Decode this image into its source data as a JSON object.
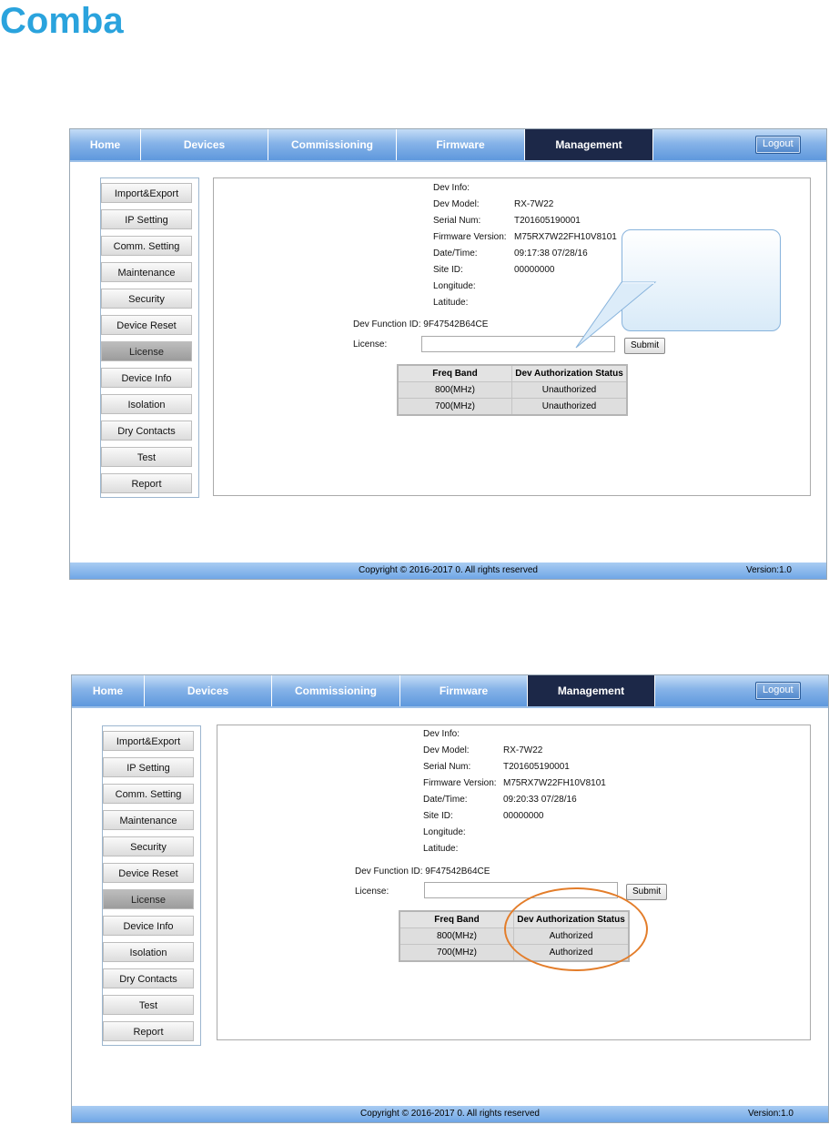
{
  "brand": {
    "logo_text": "Comba"
  },
  "screens": [
    {
      "nav": {
        "tabs": [
          "Home",
          "Devices",
          "Commissioning",
          "Firmware",
          "Management"
        ],
        "active": "Management",
        "logout": "Logout"
      },
      "menu": [
        "Import&Export",
        "IP Setting",
        "Comm. Setting",
        "Maintenance",
        "Security",
        "Device Reset",
        "License",
        "Device Info",
        "Isolation",
        "Dry Contacts",
        "Test",
        "Report"
      ],
      "active_menu": "License",
      "dev_info": {
        "title": "Dev Info:",
        "rows": [
          {
            "label": "Dev Model:",
            "value": "RX-7W22"
          },
          {
            "label": "Serial Num:",
            "value": "T201605190001"
          },
          {
            "label": "Firmware Version:",
            "value": "M75RX7W22FH10V8101"
          },
          {
            "label": "Date/Time:",
            "value": "09:17:38 07/28/16"
          },
          {
            "label": "Site ID:",
            "value": "00000000"
          },
          {
            "label": "Longitude:",
            "value": ""
          },
          {
            "label": "Latitude:",
            "value": ""
          }
        ]
      },
      "function_id": "Dev Function ID: 9F47542B64CE",
      "license": {
        "label": "License:",
        "value": "",
        "submit": "Submit"
      },
      "table": {
        "headers": [
          "Freq Band",
          "Dev Authorization Status"
        ],
        "rows": [
          [
            "800(MHz)",
            "Unauthorized"
          ],
          [
            "700(MHz)",
            "Unauthorized"
          ]
        ]
      },
      "footer": {
        "copyright": "Copyright © 2016-2017 0. All rights reserved",
        "version": "Version:1.0"
      }
    },
    {
      "nav": {
        "tabs": [
          "Home",
          "Devices",
          "Commissioning",
          "Firmware",
          "Management"
        ],
        "active": "Management",
        "logout": "Logout"
      },
      "menu": [
        "Import&Export",
        "IP Setting",
        "Comm. Setting",
        "Maintenance",
        "Security",
        "Device Reset",
        "License",
        "Device Info",
        "Isolation",
        "Dry Contacts",
        "Test",
        "Report"
      ],
      "active_menu": "License",
      "dev_info": {
        "title": "Dev Info:",
        "rows": [
          {
            "label": "Dev Model:",
            "value": "RX-7W22"
          },
          {
            "label": "Serial Num:",
            "value": "T201605190001"
          },
          {
            "label": "Firmware Version:",
            "value": "M75RX7W22FH10V8101"
          },
          {
            "label": "Date/Time:",
            "value": "09:20:33 07/28/16"
          },
          {
            "label": "Site ID:",
            "value": "00000000"
          },
          {
            "label": "Longitude:",
            "value": ""
          },
          {
            "label": "Latitude:",
            "value": ""
          }
        ]
      },
      "function_id": "Dev Function ID: 9F47542B64CE",
      "license": {
        "label": "License:",
        "value": "",
        "submit": "Submit"
      },
      "table": {
        "headers": [
          "Freq Band",
          "Dev Authorization Status"
        ],
        "rows": [
          [
            "800(MHz)",
            "Authorized"
          ],
          [
            "700(MHz)",
            "Authorized"
          ]
        ]
      },
      "footer": {
        "copyright": "Copyright © 2016-2017 0. All rights reserved",
        "version": "Version:1.0"
      }
    }
  ],
  "colors": {
    "logo": "#2aa3dd",
    "nav_active": "#1c2848",
    "highlight": "#e37d2a"
  }
}
